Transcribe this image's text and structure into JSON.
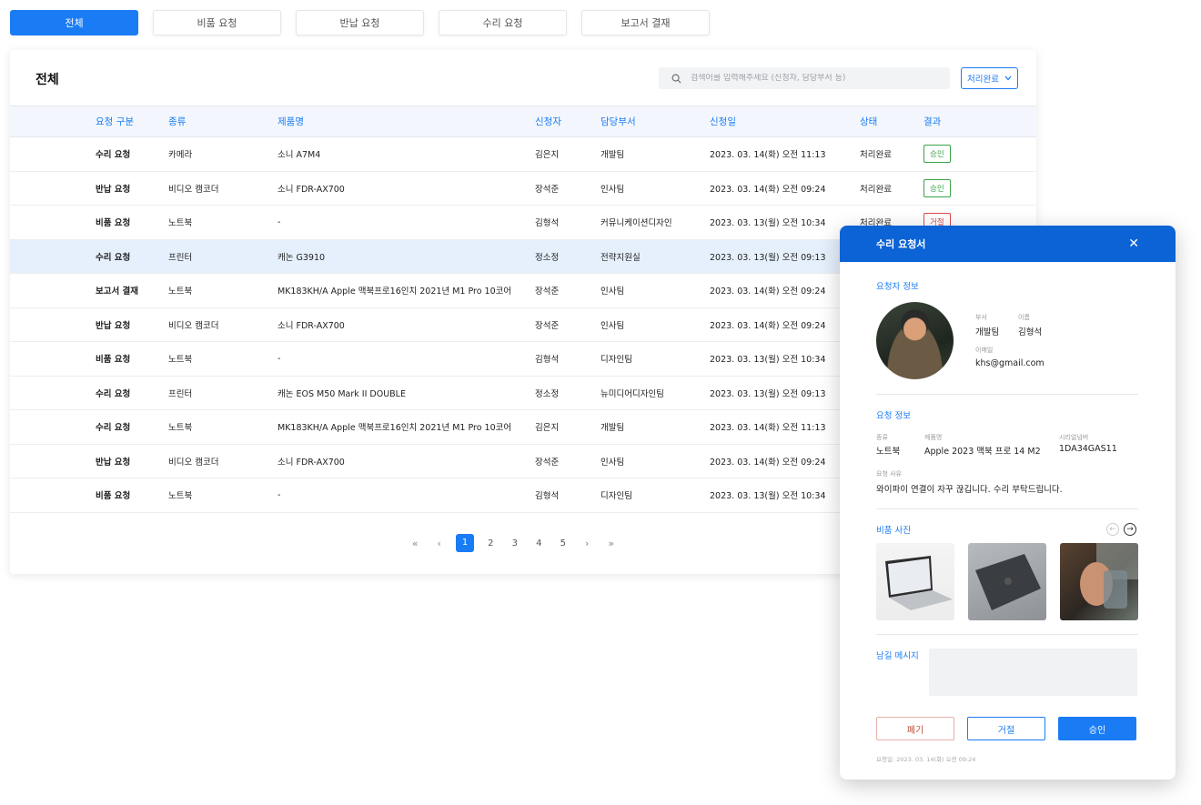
{
  "tabs": [
    "전체",
    "비품 요청",
    "반납 요청",
    "수리 요청",
    "보고서 결재"
  ],
  "card": {
    "title": "전체",
    "search_placeholder": "검색어를 입력해주세요 (신청자, 담당부서 등)",
    "filter_label": "처리완료"
  },
  "table": {
    "headers": [
      "요청 구분",
      "종류",
      "제품명",
      "신청자",
      "담당부서",
      "신청일",
      "상태",
      "결과"
    ],
    "rows": [
      {
        "type": "수리 요청",
        "kind": "카메라",
        "product": "소니 A7M4",
        "applicant": "김은지",
        "dept": "개발팀",
        "date": "2023. 03. 14(화) 오전 11:13",
        "status": "처리완료",
        "result": "승인"
      },
      {
        "type": "반납 요청",
        "kind": "비디오 캠코더",
        "product": "소니 FDR-AX700",
        "applicant": "장석준",
        "dept": "인사팀",
        "date": "2023. 03. 14(화) 오전 09:24",
        "status": "처리완료",
        "result": "승인"
      },
      {
        "type": "비품 요청",
        "kind": "노트북",
        "product": "-",
        "applicant": "김형석",
        "dept": "커뮤니케이션디자인",
        "date": "2023. 03. 13(월) 오전 10:34",
        "status": "처리완료",
        "result": "거절"
      },
      {
        "type": "수리 요청",
        "kind": "프린터",
        "product": "캐논 G3910",
        "applicant": "정소정",
        "dept": "전략지원실",
        "date": "2023. 03. 13(월) 오전 09:13",
        "status": "",
        "result": ""
      },
      {
        "type": "보고서 결재",
        "kind": "노트북",
        "product": "MK183KH/A Apple 맥북프로16인치 2021년 M1 Pro 10코어",
        "applicant": "장석준",
        "dept": "인사팀",
        "date": "2023. 03. 14(화) 오전 09:24",
        "status": "",
        "result": ""
      },
      {
        "type": "반납 요청",
        "kind": "비디오 캠코더",
        "product": "소니 FDR-AX700",
        "applicant": "장석준",
        "dept": "인사팀",
        "date": "2023. 03. 14(화) 오전 09:24",
        "status": "",
        "result": ""
      },
      {
        "type": "비품 요청",
        "kind": "노트북",
        "product": "-",
        "applicant": "김형석",
        "dept": "디자인팀",
        "date": "2023. 03. 13(월) 오전 10:34",
        "status": "",
        "result": ""
      },
      {
        "type": "수리 요청",
        "kind": "프린터",
        "product": "캐논 EOS M50 Mark II DOUBLE",
        "applicant": "정소정",
        "dept": "뉴미디어디자인팀",
        "date": "2023. 03. 13(월) 오전 09:13",
        "status": "",
        "result": ""
      },
      {
        "type": "수리 요청",
        "kind": "노트북",
        "product": "MK183KH/A Apple 맥북프로16인치 2021년 M1 Pro 10코어",
        "applicant": "김은지",
        "dept": "개발팀",
        "date": "2023. 03. 14(화) 오전 11:13",
        "status": "",
        "result": ""
      },
      {
        "type": "반납 요청",
        "kind": "비디오 캠코더",
        "product": "소니 FDR-AX700",
        "applicant": "장석준",
        "dept": "인사팀",
        "date": "2023. 03. 14(화) 오전 09:24",
        "status": "",
        "result": ""
      },
      {
        "type": "비품 요청",
        "kind": "노트북",
        "product": "-",
        "applicant": "김형석",
        "dept": "디자인팀",
        "date": "2023. 03. 13(월) 오전 10:34",
        "status": "",
        "result": ""
      }
    ]
  },
  "pagination": {
    "first": "«",
    "prev": "‹",
    "pages": [
      "1",
      "2",
      "3",
      "4",
      "5"
    ],
    "current": "1",
    "next": "›",
    "last": "»"
  },
  "modal": {
    "title": "수리 요청서",
    "requester_section": "요청자 정보",
    "dept_label": "부서",
    "dept": "개발팀",
    "name_label": "이름",
    "name": "김형석",
    "email_label": "이메일",
    "email": "khs@gmail.com",
    "request_section": "요청 정보",
    "kind_label": "종류",
    "kind": "노트북",
    "product_label": "제품명",
    "product": "Apple 2023 맥북 프로 14 M2",
    "serial_label": "시리얼넘버",
    "serial": "1DA34GAS11",
    "reason_label": "요청 사유",
    "reason": "와이파이 연결이 자꾸 끊깁니다. 수리 부탁드립니다.",
    "photos_section": "비품 사진",
    "message_label": "남길 메시지",
    "discard": "폐기",
    "reject": "거절",
    "approve": "승인",
    "footer": "요청일: 2023. 03. 14(화) 오전 09:24"
  },
  "colors": {
    "accent": "#1a7cf5",
    "modal_header": "#0b63d6",
    "approve_badge": "#38a34a",
    "reject_badge": "#e04848",
    "selected_row": "#e6f0fc"
  }
}
